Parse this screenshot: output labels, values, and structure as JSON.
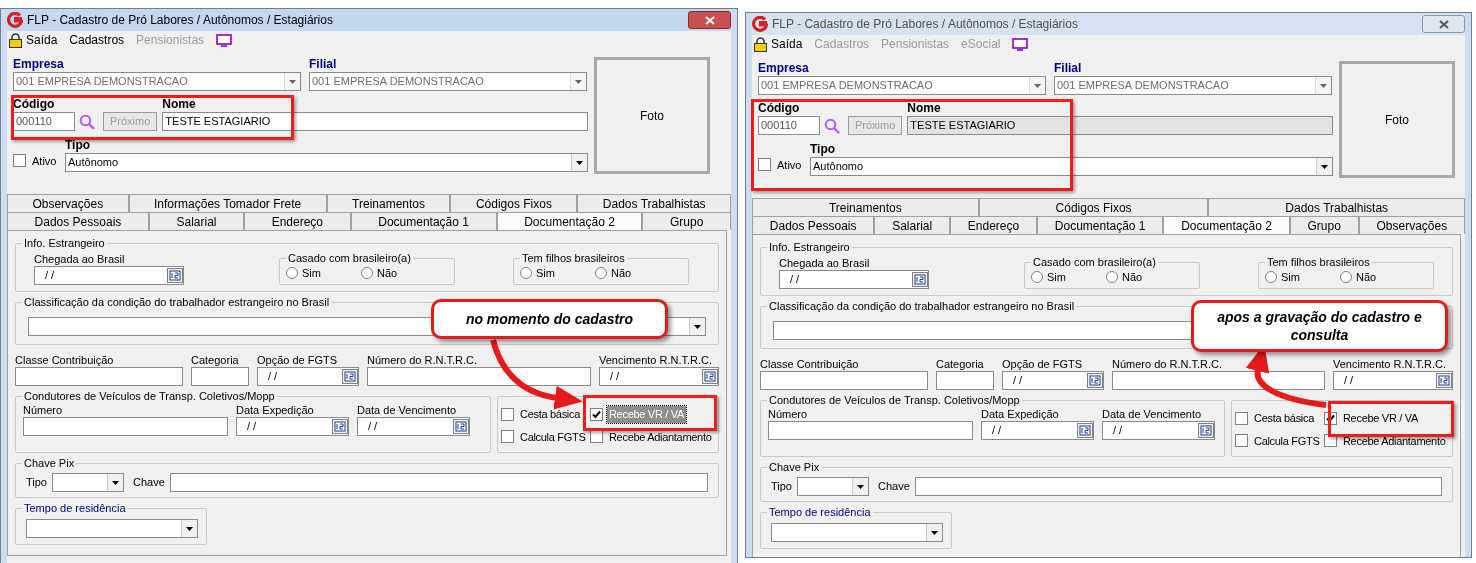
{
  "windows": [
    {
      "title": "FLP - Cadastro de Pró Labores / Autônomos / Estagiários",
      "active": true,
      "menu": [
        {
          "label": "Saída",
          "disabled": false
        },
        {
          "label": "Cadastros",
          "disabled": false
        },
        {
          "label": "Pensionistas",
          "disabled": true
        }
      ],
      "empresa": {
        "label": "Empresa",
        "value": "001 EMPRESA DEMONSTRACAO"
      },
      "filial": {
        "label": "Filial",
        "value": "001 EMPRESA DEMONSTRACAO"
      },
      "codigo": {
        "label": "Código",
        "value": "000110"
      },
      "proximo": {
        "label": "Próximo",
        "disabled": true
      },
      "nome": {
        "label": "Nome",
        "value": "TESTE ESTAGIARIO",
        "disabled": false
      },
      "ativo": {
        "label": "Ativo",
        "checked": false
      },
      "tipo": {
        "label": "Tipo",
        "value": "Autônomo"
      },
      "foto": "Foto",
      "tab_rows": [
        [
          {
            "label": "Observações",
            "selected": false
          },
          {
            "label": "Informações Tomador Frete",
            "selected": false
          },
          {
            "label": "Treinamentos",
            "selected": false
          },
          {
            "label": "Códigos Fixos",
            "selected": false
          },
          {
            "label": "Dados Trabalhistas",
            "selected": false
          }
        ],
        [
          {
            "label": "Dados Pessoais",
            "selected": false
          },
          {
            "label": "Salarial",
            "selected": false
          },
          {
            "label": "Endereço",
            "selected": false
          },
          {
            "label": "Documentação 1",
            "selected": false
          },
          {
            "label": "Documentação 2",
            "selected": true
          },
          {
            "label": "Grupo",
            "selected": false
          }
        ]
      ],
      "info_estrangeiro": {
        "title": "Info. Estrangeiro",
        "chegada": {
          "label": "Chegada ao Brasil",
          "value": "/ /"
        },
        "groups": [
          {
            "title": "Casado com brasileiro(a)",
            "options": [
              {
                "label": "Sim",
                "selected": false
              },
              {
                "label": "Não",
                "selected": false
              }
            ]
          },
          {
            "title": "Tem filhos brasileiros",
            "options": [
              {
                "label": "Sim",
                "selected": false
              },
              {
                "label": "Não",
                "selected": false
              }
            ]
          }
        ]
      },
      "classificacao": {
        "title": "Classificação da condição do trabalhador estrangeiro no Brasil"
      },
      "fields": [
        {
          "label": "Classe Contribuição",
          "kind": "text"
        },
        {
          "label": "Categoria",
          "kind": "text"
        },
        {
          "label": "Opção de FGTS",
          "kind": "date",
          "value": "/ /"
        },
        {
          "label": "Número do R.N.T.R.C.",
          "kind": "text"
        },
        {
          "label": "Vencimento R.N.T.R.C.",
          "kind": "date",
          "value": "/ /"
        }
      ],
      "condutores": {
        "title": "Condutores de Veículos de Transp. Coletivos/Mopp",
        "fields": [
          {
            "label": "Número",
            "kind": "text"
          },
          {
            "label": "Data Expedição",
            "kind": "date",
            "value": "/ /"
          },
          {
            "label": "Data de Vencimento",
            "kind": "date",
            "value": "/ /"
          }
        ]
      },
      "checkboxes": [
        {
          "label": "Cesta básica",
          "checked": false,
          "focused": false
        },
        {
          "label": "Recebe VR / VA",
          "checked": true,
          "focused": true
        },
        {
          "label": "Calcula FGTS",
          "checked": false,
          "focused": false
        },
        {
          "label": "Recebe Adiantamento",
          "checked": false,
          "focused": false
        }
      ],
      "chave_pix": {
        "title": "Chave Pix",
        "tipo_label": "Tipo",
        "chave_label": "Chave"
      },
      "tempo_residencia": {
        "title": "Tempo de residência"
      },
      "callout": {
        "text": "no momento do cadastro"
      }
    },
    {
      "title": "FLP - Cadastro de Pró Labores / Autônomos / Estagiários",
      "active": false,
      "menu": [
        {
          "label": "Saída",
          "disabled": false
        },
        {
          "label": "Cadastros",
          "disabled": true
        },
        {
          "label": "Pensionistas",
          "disabled": true
        },
        {
          "label": "eSocial",
          "disabled": true
        }
      ],
      "empresa": {
        "label": "Empresa",
        "value": "001 EMPRESA DEMONSTRACAO"
      },
      "filial": {
        "label": "Filial",
        "value": "001 EMPRESA DEMONSTRACAO"
      },
      "codigo": {
        "label": "Código",
        "value": "000110"
      },
      "proximo": {
        "label": "Próximo",
        "disabled": true
      },
      "nome": {
        "label": "Nome",
        "value": "TESTE ESTAGIARIO",
        "disabled": true
      },
      "ativo": {
        "label": "Ativo",
        "checked": false
      },
      "tipo": {
        "label": "Tipo",
        "value": "Autônomo"
      },
      "foto": "Foto",
      "tab_rows": [
        [
          {
            "label": "Treinamentos",
            "selected": false
          },
          {
            "label": "Códigos Fixos",
            "selected": false
          },
          {
            "label": "Dados Trabalhistas",
            "selected": false
          }
        ],
        [
          {
            "label": "Dados Pessoais",
            "selected": false
          },
          {
            "label": "Salarial",
            "selected": false
          },
          {
            "label": "Endereço",
            "selected": false
          },
          {
            "label": "Documentação 1",
            "selected": false
          },
          {
            "label": "Documentação 2",
            "selected": true
          },
          {
            "label": "Grupo",
            "selected": false
          },
          {
            "label": "Observações",
            "selected": false
          }
        ]
      ],
      "info_estrangeiro": {
        "title": "Info. Estrangeiro",
        "chegada": {
          "label": "Chegada ao Brasil",
          "value": "/ /"
        },
        "groups": [
          {
            "title": "Casado com brasileiro(a)",
            "options": [
              {
                "label": "Sim",
                "selected": false
              },
              {
                "label": "Não",
                "selected": false
              }
            ]
          },
          {
            "title": "Tem filhos brasileiros",
            "options": [
              {
                "label": "Sim",
                "selected": false
              },
              {
                "label": "Não",
                "selected": false
              }
            ]
          }
        ]
      },
      "classificacao": {
        "title": "Classificação da condição do trabalhador estrangeiro no Brasil"
      },
      "fields": [
        {
          "label": "Classe Contribuição",
          "kind": "text"
        },
        {
          "label": "Categoria",
          "kind": "text"
        },
        {
          "label": "Opção de FGTS",
          "kind": "date",
          "value": "/ /"
        },
        {
          "label": "Número do R.N.T.R.C.",
          "kind": "text"
        },
        {
          "label": "Vencimento R.N.T.R.C.",
          "kind": "date",
          "value": "/ /"
        }
      ],
      "condutores": {
        "title": "Condutores de Veículos de Transp. Coletivos/Mopp",
        "fields": [
          {
            "label": "Número",
            "kind": "text"
          },
          {
            "label": "Data Expedição",
            "kind": "date",
            "value": "/ /"
          },
          {
            "label": "Data de Vencimento",
            "kind": "date",
            "value": "/ /"
          }
        ]
      },
      "checkboxes": [
        {
          "label": "Cesta básica",
          "checked": false,
          "focused": false
        },
        {
          "label": "Recebe VR / VA",
          "checked": true,
          "focused": false
        },
        {
          "label": "Calcula FGTS",
          "checked": false,
          "focused": false
        },
        {
          "label": "Recebe Adiantamento",
          "checked": false,
          "focused": false
        }
      ],
      "chave_pix": {
        "title": "Chave Pix",
        "tipo_label": "Tipo",
        "chave_label": "Chave"
      },
      "tempo_residencia": {
        "title": "Tempo de residência"
      },
      "callout": {
        "text": "apos a gravação do cadastro e consulta"
      }
    }
  ]
}
